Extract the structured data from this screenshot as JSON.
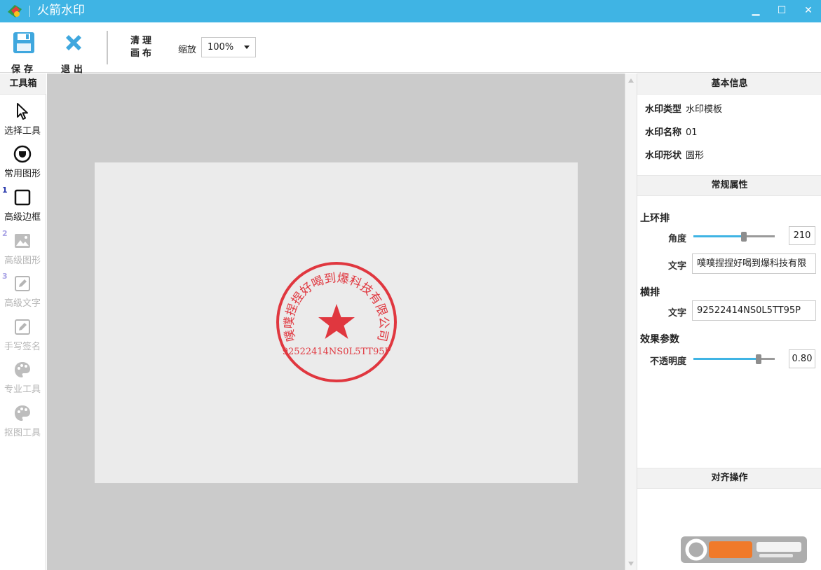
{
  "window": {
    "title": "火箭水印",
    "minimize": "▁",
    "maximize": "☐",
    "close": "✕"
  },
  "toolbar": {
    "save_label": "保存",
    "exit_label": "退出",
    "clear_line1": "清理",
    "clear_line2": "画布",
    "zoom_label": "缩放",
    "zoom_value": "100%"
  },
  "toolbox": {
    "header": "工具箱",
    "items": [
      {
        "label": "选择工具",
        "icon": "cursor-icon",
        "number": ""
      },
      {
        "label": "常用图形",
        "icon": "circle-shape-icon",
        "number": ""
      },
      {
        "label": "高级边框",
        "icon": "square-frame-icon",
        "number": "1"
      },
      {
        "label": "高级图形",
        "icon": "image-icon",
        "number": "2"
      },
      {
        "label": "高级文字",
        "icon": "edit-text-icon",
        "number": "3"
      },
      {
        "label": "手写签名",
        "icon": "signature-icon",
        "number": ""
      },
      {
        "label": "专业工具",
        "icon": "palette-icon",
        "number": ""
      },
      {
        "label": "抠图工具",
        "icon": "palette-icon",
        "number": ""
      }
    ]
  },
  "seal": {
    "arc_text": "噗噗捏捏好喝到爆科技有限公司",
    "code_text": "92522414NS0L5TT95P",
    "color": "#e0373f"
  },
  "panel": {
    "basic_header": "基本信息",
    "info": [
      {
        "key": "水印类型",
        "value": "水印模板"
      },
      {
        "key": "水印名称",
        "value": "01"
      },
      {
        "key": "水印形状",
        "value": "圆形"
      }
    ],
    "general_header": "常规属性",
    "upper_ring_title": "上环排",
    "angle_label": "角度",
    "angle_value": "210",
    "angle_fraction": 0.62,
    "upper_text_label": "文字",
    "upper_text_value": "噗噗捏捏好喝到爆科技有限",
    "horizontal_title": "横排",
    "horizontal_text_label": "文字",
    "horizontal_text_value": "92522414NS0L5TT95P",
    "effect_title": "效果参数",
    "opacity_label": "不透明度",
    "opacity_value": "0.80",
    "opacity_fraction": 0.8,
    "align_header": "对齐操作"
  },
  "colors": {
    "titlebar": "#3fb4e4",
    "accent": "#3fb4e4",
    "seal_red": "#e0373f"
  }
}
